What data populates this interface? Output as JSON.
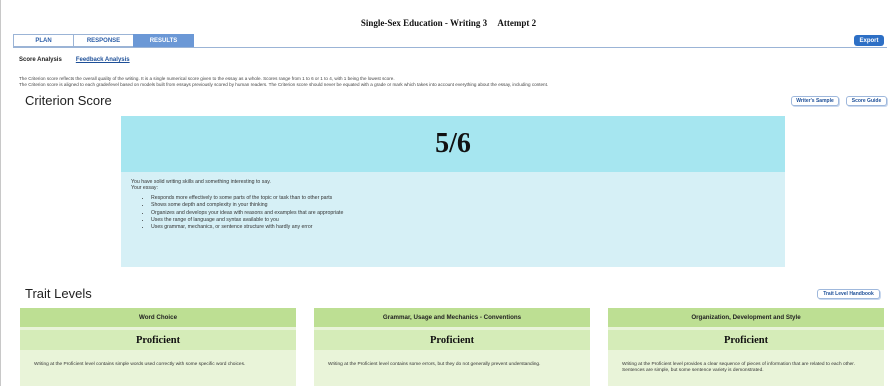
{
  "header": {
    "title": "Single-Sex Education - Writing 3",
    "attempt": "Attempt 2"
  },
  "tabs": [
    {
      "label": "PLAN"
    },
    {
      "label": "RESPONSE"
    },
    {
      "label": "RESULTS"
    }
  ],
  "export_label": "Export",
  "subtabs": {
    "score_analysis": "Score Analysis",
    "feedback_analysis": "Feedback Analysis"
  },
  "description": {
    "line1": "The Criterion score reflects the overall quality of the writing. It is a single numerical score given to the essay as a whole. Scores range from 1 to 6 or 1 to 4, with 1 being the lowest score.",
    "line2": "The Criterion score is aligned to each grade/level based on models built from essays previously scored by human readers. The Criterion score should never be equated with a grade or mark which takes into account everything about the essay, including content."
  },
  "criterion": {
    "title": "Criterion Score",
    "writers_sample_label": "Writer's Sample",
    "score_guide_label": "Score Guide",
    "score": "5/6",
    "summary": "You have solid writing skills and something interesting to say.",
    "your_essay": "Your essay:",
    "bullets": [
      "Responds more effectively to some parts of the topic or task than to other parts",
      "Shows some depth and complexity in your thinking",
      "Organizes and develops your ideas with reasons and examples that are appropriate",
      "Uses the range of language and syntax available to you",
      "Uses grammar, mechanics, or sentence structure with hardly any error"
    ]
  },
  "traits": {
    "title": "Trait Levels",
    "handbook_label": "Trait Level Handbook",
    "cards": [
      {
        "name": "Word Choice",
        "level": "Proficient",
        "description": "Writing at the Proficient level contains simple words used correctly with some specific word choices."
      },
      {
        "name": "Grammar, Usage and Mechanics - Conventions",
        "level": "Proficient",
        "description": "Writing at the Proficient level contains some errors, but they do not generally prevent understanding."
      },
      {
        "name": "Organization, Development and Style",
        "level": "Proficient",
        "description": "Writing at the Proficient level provides a clear sequence of pieces of information that are related to each other. Sentences are simple, but some sentence variety is demonstrated."
      }
    ]
  }
}
